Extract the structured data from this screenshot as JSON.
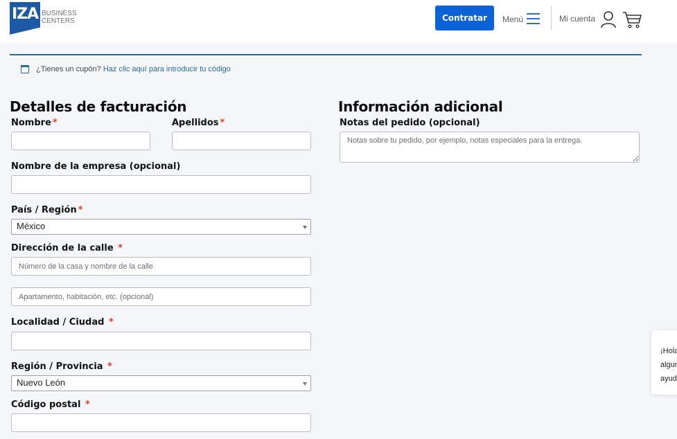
{
  "brand": {
    "logo_text": "IZA",
    "sub_line1": "BUSINESS",
    "sub_line2": "CENTERS"
  },
  "header": {
    "cta_label": "Contratar",
    "menu_label": "Menú",
    "account_label": "Mi cuenta"
  },
  "coupon": {
    "prompt": "¿Tienes un cupón?",
    "link": "Haz clic aquí para introducir tu código"
  },
  "billing": {
    "title": "Detalles de facturación",
    "first_name_label": "Nombre",
    "last_name_label": "Apellidos",
    "company_label": "Nombre de la empresa (opcional)",
    "country_label": "País / Región",
    "country_value": "México",
    "street_label": "Dirección de la calle",
    "street1_placeholder": "Número de la casa y nombre de la calle",
    "street2_placeholder": "Apartamento, habitación, etc. (opcional)",
    "city_label": "Localidad / Ciudad",
    "state_label": "Región / Provincia",
    "state_value": "Nuevo León",
    "postcode_label": "Código postal",
    "required_mark": "*"
  },
  "additional": {
    "title": "Información adicional",
    "notes_label": "Notas del pedido (opcional)",
    "notes_placeholder": "Notas sobre tu pedido, por ejemplo, notas especiales para la entrega."
  },
  "chat": {
    "line1": "¡Hola",
    "line2": "algun",
    "line3": "ayud"
  },
  "colors": {
    "primary": "#0b62d6",
    "brand": "#1d5aa6",
    "link": "#1f6aa5",
    "required": "#e2401c"
  }
}
